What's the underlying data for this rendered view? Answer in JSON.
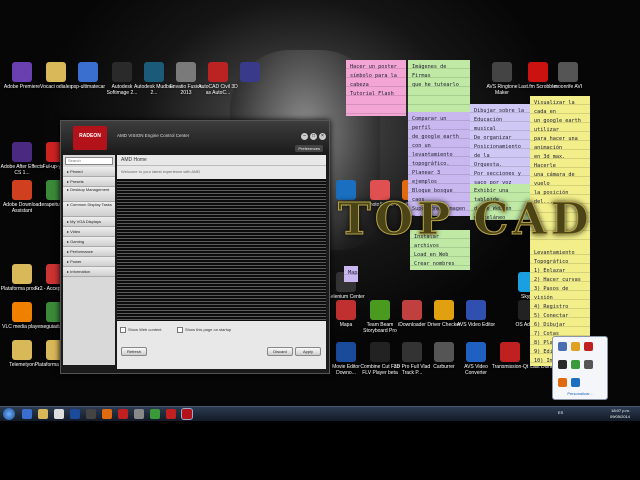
{
  "desktop_icons": [
    {
      "label": "Adobe Premiere",
      "color": "#6a3fb0"
    },
    {
      "label": "Vocaci odiales",
      "color": "#d9b85a"
    },
    {
      "label": "psp-ultimatecar",
      "color": "#3a6fd0"
    },
    {
      "label": "Autodesk Softimage 2...",
      "color": "#2a2a2a"
    },
    {
      "label": "Autodesk Mudbox 2...",
      "color": "#1c5a7a"
    },
    {
      "label": "Envatio Fusion 2013",
      "color": "#7a7a7a"
    },
    {
      "label": "AutoCAD Civil 3D as AutoC...",
      "color": "#b22"
    },
    {
      "label": "",
      "color": "#3a3a8a"
    },
    {
      "label": "AVS Ringtone Maker",
      "color": "#444"
    },
    {
      "label": "Last.fm Scrobbler",
      "color": "#c11"
    },
    {
      "label": "moonrife AVI",
      "color": "#555"
    },
    {
      "label": "Adobe After Effects CS 1...",
      "color": "#4a2a80"
    },
    {
      "label": "Ful-up-ymm",
      "color": "#c22"
    },
    {
      "label": "Adobe Download Assistant",
      "color": "#d04020"
    },
    {
      "label": "terapeitufla_m",
      "color": "#3a8a3a"
    },
    {
      "label": "Plataforma produ...",
      "color": "#d9b85a"
    },
    {
      "label": "Fr2 - Accept Media",
      "color": "#c33"
    },
    {
      "label": "VLC media player",
      "color": "#f08000"
    },
    {
      "label": "seguiaduriam",
      "color": "#3a8a3a"
    },
    {
      "label": "Telemetyon",
      "color": "#d9b85a"
    },
    {
      "label": "Plataforma produ...",
      "color": "#d9b85a"
    },
    {
      "label": "HP",
      "color": "#1a6fc0"
    },
    {
      "label": "PhotoScape",
      "color": "#e05050"
    },
    {
      "label": "Mozilla Firefox",
      "color": "#e06a10"
    },
    {
      "label": "Selenium Center",
      "color": "#333"
    },
    {
      "label": "Skype",
      "color": "#1aa0e0"
    },
    {
      "label": "Mapa",
      "color": "#c03030"
    },
    {
      "label": "Team Beam Storyboard Pro",
      "color": "#4a9a20"
    },
    {
      "label": "iDownloader",
      "color": "#c04040"
    },
    {
      "label": "Driver Checker",
      "color": "#e0a010"
    },
    {
      "label": "AVS Video Editor",
      "color": "#3050b0"
    },
    {
      "label": "OS Advisor",
      "color": "#222"
    },
    {
      "label": "Movie Editor Downo...",
      "color": "#1a4a9a"
    },
    {
      "label": "Combine Cut Fab FLV Player beta",
      "color": "#222"
    },
    {
      "label": "3D Pro Full Vlad Track P...",
      "color": "#333"
    },
    {
      "label": "Carburrer",
      "color": "#555"
    },
    {
      "label": "AVS Video Converter",
      "color": "#2060c0"
    },
    {
      "label": "Transmission-Qt",
      "color": "#c02020"
    },
    {
      "label": "Last Dishu",
      "color": "#333"
    }
  ],
  "notes": [
    {
      "text": "Hacer un poster\nsímbolo para la\ncabeza\nTutorial Flash",
      "color": "#f3a6d6"
    },
    {
      "text": "Imágenes de Firmas\nque he tutearlo",
      "color": "#bfe9a4"
    },
    {
      "text": "Comparar un perfil\nde google earth con un\nlevantamiento\ntopográfico.\nPlanear 3 ejemplos\nBloque bosque caos\nSuperponer imagen\nRedibujar en imagen\nDisegnar vista\nsuperponer perfil en CE",
      "color": "#c9b8f0"
    },
    {
      "text": "Dibujar sobre la\nEducación musical\nDe organizar\nPosicionamiento de la\nOrquesta.\nPor secciones y\nsaco por voz",
      "color": "#cfc8f5"
    },
    {
      "text": "Visualizar la cada en\nun google earth utilizar\npara hacer una animación\nen 3d max. Hacerle\nuna cámara de vuelo\nla posición del...",
      "color": "#f2ee8a"
    },
    {
      "text": "Exhibir una tabloide\ndesde Web en\nmisceláneo",
      "color": "#bfe9a4"
    },
    {
      "text": "Instalar archivos\nLoad en Web\nCrear nombres",
      "color": "#bfe9a4"
    },
    {
      "text": "Mapa",
      "color": "#c9b8f0"
    },
    {
      "text": "Levantamiento\nTopográfico\n1) Enlazar\n2) Hacer curvas\n3) Pasos de visión\n4) Registro\n5) Conectar\n6) Dibujar\n7) Cotas\n8) Planos\n9) Editar\n10) Impresión",
      "color": "#f2ee8a"
    }
  ],
  "watermark": "TOP CAD",
  "window": {
    "title": "AMD VISION Engine Control Center",
    "brand": "RADEON",
    "preferences": "Preferences",
    "search_placeholder": "Search",
    "tooltip": "Home",
    "breadcrumb": "AMD Home",
    "welcome": "Welcome to your latest experience with AMD",
    "nav": [
      "Pinned",
      "Presets",
      "Desktop Management",
      "Common Display Tasks",
      "My VGA Displays",
      "Video",
      "Gaming",
      "Performance",
      "Power",
      "Information"
    ],
    "checkbox_1": "Show Web content",
    "checkbox_2": "Show this page on startup",
    "btn_refresh": "Refresh",
    "btn_discard": "Discard",
    "btn_apply": "Apply"
  },
  "tray_popup": {
    "customize": "Personalizar..."
  },
  "taskbar": {
    "time": "18:07 p.m.",
    "date": "09/05/2014",
    "lang": "ES"
  },
  "colors": {
    "amd_red": "#b3121b",
    "taskbar": "#1e2a3a"
  }
}
